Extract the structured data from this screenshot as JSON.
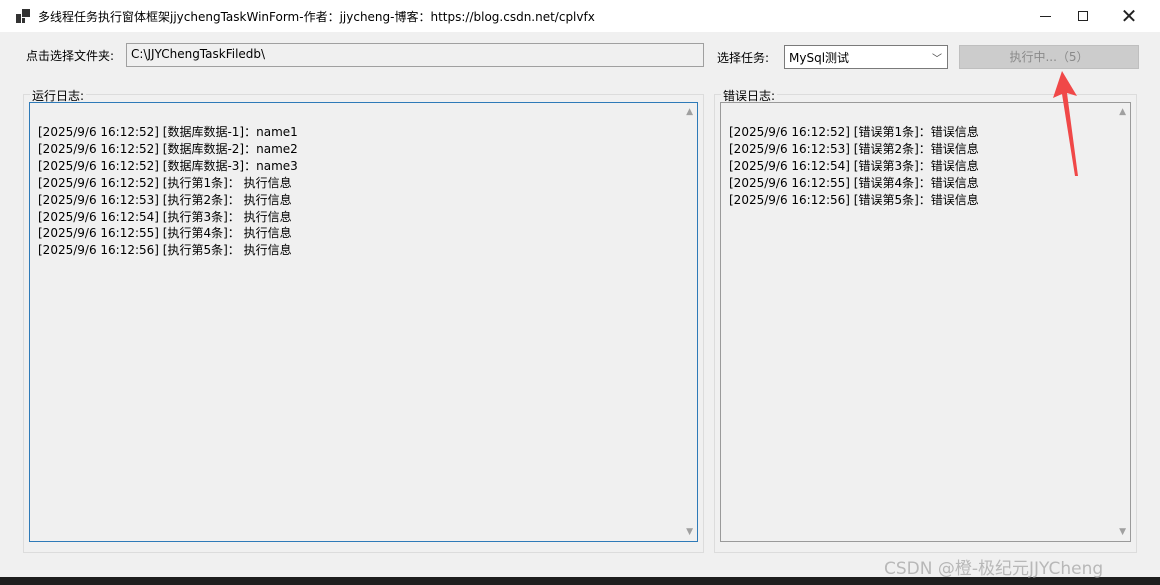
{
  "window": {
    "title": "多线程任务执行窗体框架jjychengTaskWinForm-作者：jjycheng-博客：https://blog.csdn.net/cplvfx",
    "minimize_glyph": "—",
    "close_glyph": "✕"
  },
  "toolbar": {
    "folder_label": "点击选择文件夹:",
    "folder_value": "C:\\JJYChengTaskFiledb\\",
    "task_label": "选择任务:",
    "task_selected": "MySql测试",
    "run_button_label": "执行中...（5）"
  },
  "run_log": {
    "title": "运行日志:",
    "lines": [
      "[2025/9/6 16:12:52] [数据库数据-1]：name1",
      "[2025/9/6 16:12:52] [数据库数据-2]：name2",
      "[2025/9/6 16:12:52] [数据库数据-3]：name3",
      "[2025/9/6 16:12:52] [执行第1条]： 执行信息",
      "[2025/9/6 16:12:53] [执行第2条]： 执行信息",
      "[2025/9/6 16:12:54] [执行第3条]： 执行信息",
      "[2025/9/6 16:12:55] [执行第4条]： 执行信息",
      "[2025/9/6 16:12:56] [执行第5条]： 执行信息"
    ]
  },
  "error_log": {
    "title": "错误日志:",
    "lines": [
      "[2025/9/6 16:12:52] [错误第1条]：错误信息",
      "[2025/9/6 16:12:53] [错误第2条]：错误信息",
      "[2025/9/6 16:12:54] [错误第3条]：错误信息",
      "[2025/9/6 16:12:55] [错误第4条]：错误信息",
      "[2025/9/6 16:12:56] [错误第5条]：错误信息"
    ]
  },
  "watermark": "CSDN @橙-极纪元JJYCheng",
  "icons": [
    "app-icon",
    "minimize-icon",
    "maximize-icon",
    "close-icon",
    "chevron-down-icon",
    "scroll-up-icon",
    "scroll-down-icon",
    "red-arrow-icon"
  ],
  "colors": {
    "arrow": "#f04848",
    "focus_border": "#2e7ab8",
    "disabled_button": "#cccccc"
  }
}
